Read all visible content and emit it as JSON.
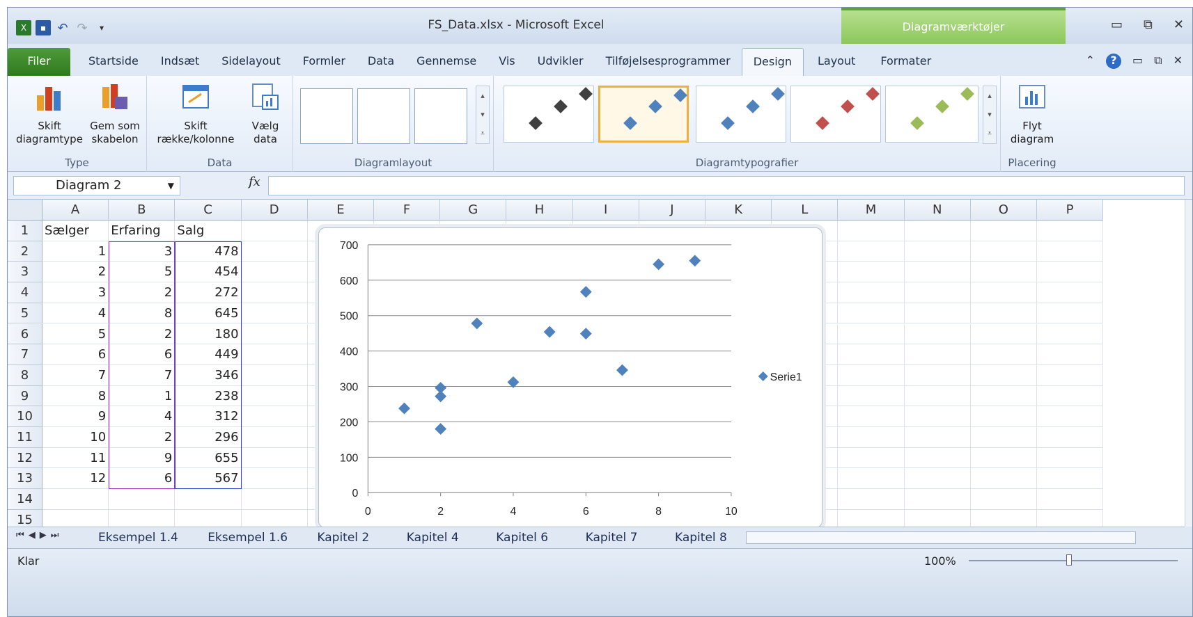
{
  "window": {
    "title": "FS_Data.xlsx  -  Microsoft Excel",
    "context_tab_group": "Diagramværktøjer"
  },
  "tabs": [
    "Filer",
    "Startside",
    "Indsæt",
    "Sidelayout",
    "Formler",
    "Data",
    "Gennemse",
    "Vis",
    "Udvikler",
    "Tilføjelsesprogrammer",
    "Design",
    "Layout",
    "Formater"
  ],
  "ribbon": {
    "type_group": {
      "label": "Type",
      "btn1": "Skift diagramtype",
      "btn2": "Gem som skabelon"
    },
    "data_group": {
      "label": "Data",
      "btn1": "Skift række/kolonne",
      "btn2": "Vælg data"
    },
    "layout_group": {
      "label": "Diagramlayout"
    },
    "styles_group": {
      "label": "Diagramtypografier"
    },
    "place_group": {
      "label": "Placering",
      "btn1": "Flyt diagram"
    }
  },
  "formula_bar": {
    "name_box": "Diagram 2",
    "fx": "fx",
    "value": ""
  },
  "columns": [
    "A",
    "B",
    "C",
    "D",
    "E",
    "F",
    "G",
    "H",
    "I",
    "J",
    "K",
    "L",
    "M",
    "N",
    "O",
    "P"
  ],
  "rows": [
    "1",
    "2",
    "3",
    "4",
    "5",
    "6",
    "7",
    "8",
    "9",
    "10",
    "11",
    "12",
    "13",
    "14",
    "15"
  ],
  "headers": {
    "a": "Sælger",
    "b": "Erfaring",
    "c": "Salg"
  },
  "data": [
    [
      "1",
      "3",
      "478"
    ],
    [
      "2",
      "5",
      "454"
    ],
    [
      "3",
      "2",
      "272"
    ],
    [
      "4",
      "8",
      "645"
    ],
    [
      "5",
      "2",
      "180"
    ],
    [
      "6",
      "6",
      "449"
    ],
    [
      "7",
      "7",
      "346"
    ],
    [
      "8",
      "1",
      "238"
    ],
    [
      "9",
      "4",
      "312"
    ],
    [
      "10",
      "2",
      "296"
    ],
    [
      "11",
      "9",
      "655"
    ],
    [
      "12",
      "6",
      "567"
    ]
  ],
  "chart_data": {
    "type": "scatter",
    "title": "",
    "xlim": [
      0,
      10
    ],
    "ylim": [
      0,
      700
    ],
    "xticks": [
      "0",
      "2",
      "4",
      "6",
      "8",
      "10"
    ],
    "yticks": [
      "0",
      "100",
      "200",
      "300",
      "400",
      "500",
      "600",
      "700"
    ],
    "series": [
      {
        "name": "Serie1",
        "color": "#4f81bd",
        "points": [
          [
            3,
            478
          ],
          [
            5,
            454
          ],
          [
            2,
            272
          ],
          [
            8,
            645
          ],
          [
            2,
            180
          ],
          [
            6,
            449
          ],
          [
            7,
            346
          ],
          [
            1,
            238
          ],
          [
            4,
            312
          ],
          [
            2,
            296
          ],
          [
            9,
            655
          ],
          [
            6,
            567
          ]
        ]
      }
    ],
    "legend": "right"
  },
  "sheet_tabs": [
    "Eksempel 1.4",
    "Eksempel 1.6",
    "Kapitel 2",
    "Kapitel 4",
    "Kapitel 6",
    "Kapitel 7",
    "Kapitel 8"
  ],
  "status": {
    "ready": "Klar",
    "zoom": "100%"
  }
}
